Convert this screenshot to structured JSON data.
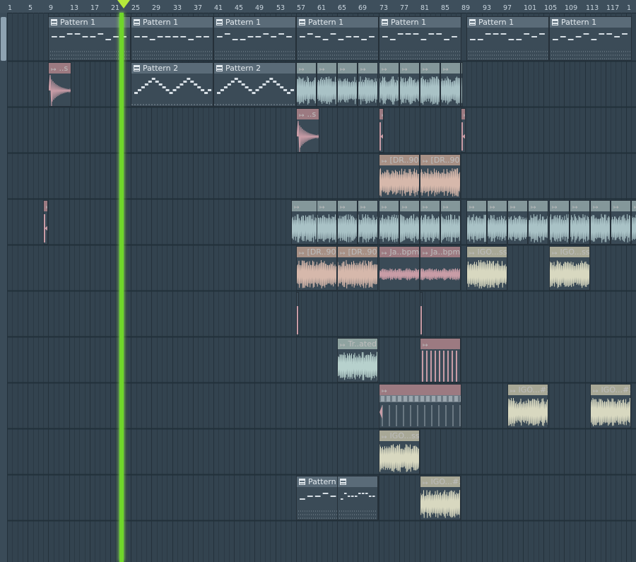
{
  "ruler": {
    "ticks": [
      "1",
      "5",
      "9",
      "13",
      "17",
      "21",
      "25",
      "29",
      "33",
      "37",
      "41",
      "45",
      "49",
      "53",
      "57",
      "61",
      "65",
      "69",
      "73",
      "77",
      "81",
      "85",
      "89",
      "93",
      "97",
      "101",
      "105",
      "109",
      "113",
      "117",
      "1"
    ]
  },
  "playhead": {
    "bar": 22
  },
  "colors": {
    "background": "#33434f",
    "ruler": "#3e4f5c",
    "playhead": "#6fd62a",
    "pattern_header": "#5a6b78"
  },
  "clips": [
    {
      "kind": "pattern",
      "label": "Pattern 1",
      "color": "#5a6b78"
    },
    {
      "kind": "pattern",
      "label": "Pattern 1",
      "color": "#5a6b78"
    },
    {
      "kind": "pattern",
      "label": "Pattern 1",
      "color": "#5a6b78"
    },
    {
      "kind": "pattern",
      "label": "Pattern 1",
      "color": "#5a6b78"
    },
    {
      "kind": "pattern",
      "label": "Pattern 1",
      "color": "#5a6b78"
    },
    {
      "kind": "pattern",
      "label": "Pattern 1",
      "color": "#5a6b78"
    },
    {
      "kind": "pattern",
      "label": "Pattern 1",
      "color": "#5a6b78"
    },
    {
      "kind": "audio",
      "label": "..s",
      "color": "#c89ca6"
    },
    {
      "kind": "pattern",
      "label": "Pattern 2",
      "color": "#5a6b78"
    },
    {
      "kind": "pattern",
      "label": "Pattern 2",
      "color": "#5a6b78"
    },
    {
      "kind": "audio",
      "label": "",
      "color": "#a9c2c6"
    },
    {
      "kind": "audio",
      "label": "",
      "color": "#a9c2c6"
    },
    {
      "kind": "audio",
      "label": "",
      "color": "#a9c2c6"
    },
    {
      "kind": "audio",
      "label": "",
      "color": "#a9c2c6"
    },
    {
      "kind": "audio",
      "label": "",
      "color": "#a9c2c6"
    },
    {
      "kind": "audio",
      "label": "",
      "color": "#a9c2c6"
    },
    {
      "kind": "audio",
      "label": "",
      "color": "#a9c2c6"
    },
    {
      "kind": "audio",
      "label": "",
      "color": "#a9c2c6"
    },
    {
      "kind": "audio",
      "label": "",
      "color": "#a9c2c6"
    },
    {
      "kind": "audio",
      "label": "..s",
      "color": "#c89ca6"
    },
    {
      "kind": "audio",
      "label": "",
      "color": "#c89ca6"
    },
    {
      "kind": "audio",
      "label": "",
      "color": "#c89ca6"
    },
    {
      "kind": "audio",
      "label": "[DR..90",
      "color": "#d6b8ab"
    },
    {
      "kind": "audio",
      "label": "[DR..90",
      "color": "#d6b8ab"
    },
    {
      "kind": "audio",
      "label": "",
      "color": "#c89ca6"
    },
    {
      "kind": "audio",
      "label": "",
      "color": "#a9c2c6"
    },
    {
      "kind": "audio",
      "label": "",
      "color": "#a9c2c6"
    },
    {
      "kind": "audio",
      "label": "",
      "color": "#a9c2c6"
    },
    {
      "kind": "audio",
      "label": "",
      "color": "#a9c2c6"
    },
    {
      "kind": "audio",
      "label": "",
      "color": "#a9c2c6"
    },
    {
      "kind": "audio",
      "label": "",
      "color": "#a9c2c6"
    },
    {
      "kind": "audio",
      "label": "",
      "color": "#a9c2c6"
    },
    {
      "kind": "audio",
      "label": "",
      "color": "#a9c2c6"
    },
    {
      "kind": "audio",
      "label": "",
      "color": "#a9c2c6"
    },
    {
      "kind": "audio",
      "label": "",
      "color": "#a9c2c6"
    },
    {
      "kind": "audio",
      "label": "",
      "color": "#a9c2c6"
    },
    {
      "kind": "audio",
      "label": "",
      "color": "#a9c2c6"
    },
    {
      "kind": "audio",
      "label": "",
      "color": "#a9c2c6"
    },
    {
      "kind": "audio",
      "label": "",
      "color": "#a9c2c6"
    },
    {
      "kind": "audio",
      "label": "",
      "color": "#a9c2c6"
    },
    {
      "kind": "audio",
      "label": "",
      "color": "#a9c2c6"
    },
    {
      "kind": "audio",
      "label": "",
      "color": "#a9c2c6"
    },
    {
      "kind": "audio",
      "label": "[DR..90",
      "color": "#d6b8ab"
    },
    {
      "kind": "audio",
      "label": "[DR..90",
      "color": "#d6b8ab"
    },
    {
      "kind": "audio",
      "label": "Ja..bpm",
      "color": "#c89ca6"
    },
    {
      "kind": "audio",
      "label": "Ja..bpm",
      "color": "#c89ca6"
    },
    {
      "kind": "audio",
      "label": "IGO...ss",
      "color": "#d8d8c0"
    },
    {
      "kind": "audio",
      "label": "IGO...ss",
      "color": "#d8d8c0"
    },
    {
      "kind": "audio",
      "label": "",
      "color": "#c89ca6"
    },
    {
      "kind": "audio",
      "label": "",
      "color": "#c89ca6"
    },
    {
      "kind": "audio",
      "label": "Tr..ated)",
      "color": "#b7d1cd"
    },
    {
      "kind": "audio",
      "label": "",
      "color": "#c89ca6"
    },
    {
      "kind": "audio",
      "label": "",
      "color": "#c89ca6"
    },
    {
      "kind": "audio",
      "label": "IGO...#2",
      "color": "#d8d8c0"
    },
    {
      "kind": "audio",
      "label": "IGO...#2",
      "color": "#d8d8c0"
    },
    {
      "kind": "audio",
      "label": "IGO...ss",
      "color": "#d8d8c0"
    },
    {
      "kind": "pattern",
      "label": "Pattern 5",
      "color": "#5a6b78"
    },
    {
      "kind": "pattern",
      "label": "",
      "color": "#5a6b78"
    },
    {
      "kind": "audio",
      "label": "IGO...#2",
      "color": "#d8d8c0"
    }
  ]
}
